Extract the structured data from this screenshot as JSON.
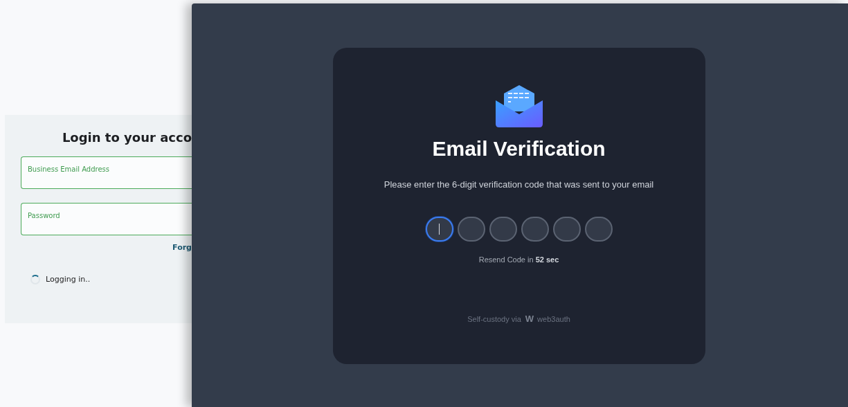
{
  "login": {
    "title": "Login to your acco",
    "fields": [
      {
        "label": "Business Email Address"
      },
      {
        "label": "Password"
      }
    ],
    "forgot_link": "Forg",
    "status": {
      "loading": true,
      "text": "Logging in.."
    }
  },
  "verification": {
    "title": "Email Verification",
    "instruction": "Please enter the 6-digit verification code that was sent to your email",
    "code_boxes": [
      {
        "focused": true
      },
      {
        "focused": false
      },
      {
        "focused": false
      },
      {
        "focused": false
      },
      {
        "focused": false
      },
      {
        "focused": false
      }
    ],
    "resend": "Resend Code in **52 sec**",
    "footer": {
      "text": "Self-custody via",
      "brand_mark": "W",
      "brand_name": "web3auth"
    }
  }
}
